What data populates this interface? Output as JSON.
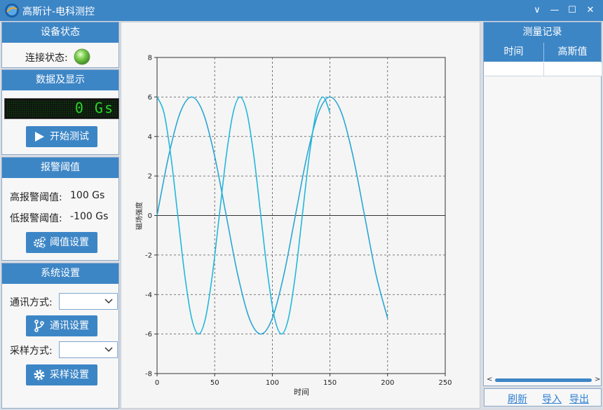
{
  "window": {
    "title": "高斯计-电科测控",
    "controls": {
      "minimize_menu": "∨",
      "minimize": "—",
      "maximize": "☐",
      "close": "✕"
    }
  },
  "device_status": {
    "header": "设备状态",
    "connection_label": "连接状态:",
    "indicator_color": "#7fcf4f"
  },
  "data_display": {
    "header": "数据及显示",
    "lcd_value": "0 Gs",
    "start_button": "开始测试"
  },
  "alarm": {
    "header": "报警阈值",
    "high_label": "高报警阈值:",
    "high_value": "100 Gs",
    "low_label": "低报警阈值:",
    "low_value": "-100 Gs",
    "settings_button": "阈值设置"
  },
  "system": {
    "header": "系统设置",
    "comm_label": "通讯方式:",
    "comm_value": "",
    "comm_button": "通讯设置",
    "sample_label": "采样方式:",
    "sample_value": "",
    "sample_button": "采样设置"
  },
  "records": {
    "header": "测量记录",
    "columns": [
      "时间",
      "高斯值"
    ],
    "rows": [],
    "refresh": "刷新",
    "import": "导入",
    "export": "导出"
  },
  "chart_data": {
    "type": "line",
    "title": "",
    "xlabel": "时间",
    "ylabel": "磁场强度",
    "xlim": [
      0,
      250
    ],
    "ylim": [
      -8,
      8
    ],
    "xticks": [
      0,
      50,
      100,
      150,
      200,
      250
    ],
    "yticks": [
      -8,
      -6,
      -4,
      -2,
      0,
      2,
      4,
      6,
      8
    ],
    "grid": true,
    "colors": [
      "#2aa6d4",
      "#21b8db"
    ],
    "series": [
      {
        "x": [
          0,
          10,
          20,
          30,
          40,
          50,
          60,
          70,
          80,
          90,
          100,
          110,
          120,
          130,
          140,
          150,
          160,
          170,
          180,
          190,
          200
        ],
        "y": [
          0,
          3,
          5.2,
          6,
          5.2,
          3,
          0,
          -3,
          -5.2,
          -6,
          -5.2,
          -3,
          0,
          3,
          5.2,
          6,
          5.2,
          3,
          0,
          -3,
          -5.2
        ]
      },
      {
        "x": [
          0,
          6,
          12,
          18,
          24,
          30,
          36,
          42,
          48,
          54,
          60,
          66,
          72,
          78,
          84,
          90,
          96,
          102,
          108,
          114,
          120,
          126,
          132,
          138,
          144,
          150
        ],
        "y": [
          6,
          5.2,
          3,
          0,
          -3,
          -5.2,
          -6,
          -5.2,
          -3,
          0,
          3,
          5.2,
          6,
          5.2,
          3,
          0,
          -3,
          -5.2,
          -6,
          -5.2,
          -3,
          0,
          3,
          5.2,
          6,
          5.2
        ]
      }
    ]
  }
}
